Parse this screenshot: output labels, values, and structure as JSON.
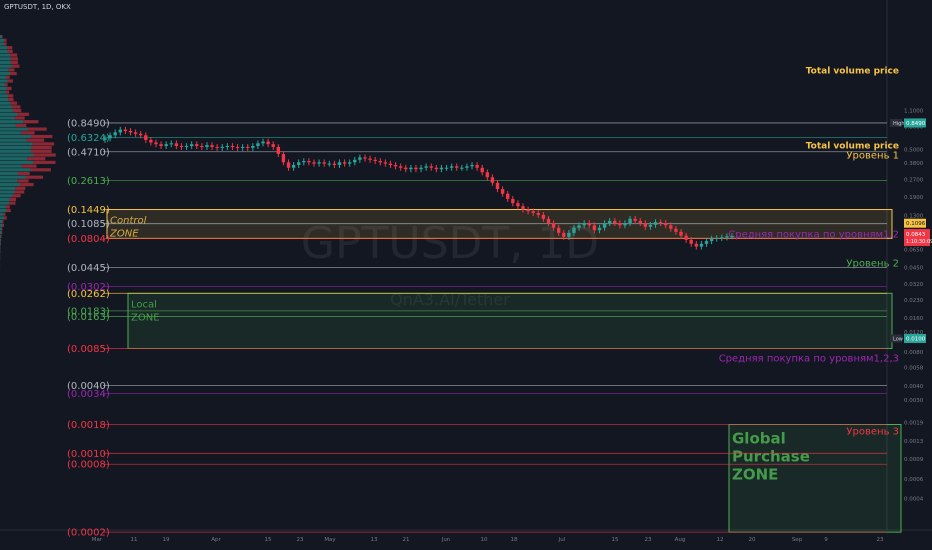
{
  "header": {
    "title": "GPTUSDT, 1D, OKX"
  },
  "watermark": {
    "ticker": "GPTUSDT, 1D",
    "desc": "QnA3.AI/Tether"
  },
  "chart_data": {
    "type": "candlestick",
    "symbol": "GPTUSDT",
    "scale": "log",
    "ylim": [
      0.0001,
      1.5
    ],
    "y_ticks": [
      1.1,
      0.8,
      0.5,
      0.38,
      0.27,
      0.19,
      0.13,
      0.09,
      0.065,
      0.045,
      0.032,
      0.023,
      0.016,
      0.012,
      0.008,
      0.0058,
      0.004,
      0.003,
      0.0019,
      0.0013,
      0.0009,
      0.0006,
      0.0004,
      0.0002,
      0.0001
    ],
    "x_ticks": [
      "Mar",
      "11",
      "19",
      "Apr",
      "15",
      "23",
      "May",
      "13",
      "21",
      "Jun",
      "10",
      "18",
      "Jul",
      "15",
      "23",
      "Aug",
      "12",
      "20",
      "Sep",
      "9",
      "23"
    ],
    "current_price": "0.1096",
    "price_tags": [
      "0.0843",
      "1:10:30:09"
    ],
    "high_label": "High",
    "high_value": "0.8490",
    "low_label": "Low",
    "low_value": "0.0100",
    "levels": [
      {
        "label": "(0.8490)",
        "value": 0.849,
        "color": "#b2b5be"
      },
      {
        "label": "(0.6324)",
        "value": 0.6324,
        "color": "#26a69a"
      },
      {
        "label": "(0.4710)",
        "value": 0.471,
        "color": "#b2b5be"
      },
      {
        "label": "(0.2613)",
        "value": 0.2613,
        "color": "#4caf50"
      },
      {
        "label": "(0.1449)",
        "value": 0.1449,
        "color": "#f6c343"
      },
      {
        "label": "(0.1085)",
        "value": 0.1085,
        "color": "#b2b5be"
      },
      {
        "label": "(0.0804)",
        "value": 0.0804,
        "color": "#f23645"
      },
      {
        "label": "(0.0445)",
        "value": 0.0445,
        "color": "#b2b5be"
      },
      {
        "label": "(0.0302)",
        "value": 0.0302,
        "color": "#9c27b0"
      },
      {
        "label": "(0.0262)",
        "value": 0.0262,
        "color": "#f6c343"
      },
      {
        "label": "(0.0183)",
        "value": 0.0183,
        "color": "#4caf50"
      },
      {
        "label": "(0.0163)",
        "value": 0.0163,
        "color": "#4caf50"
      },
      {
        "label": "(0.0085)",
        "value": 0.0085,
        "color": "#f23645"
      },
      {
        "label": "(0.0040)",
        "value": 0.004,
        "color": "#b2b5be"
      },
      {
        "label": "(0.0034)",
        "value": 0.0034,
        "color": "#9c27b0"
      },
      {
        "label": "(0.0018)",
        "value": 0.0018,
        "color": "#f23645"
      },
      {
        "label": "(0.0010)",
        "value": 0.001,
        "color": "#f23645"
      },
      {
        "label": "(0.0008)",
        "value": 0.0008,
        "color": "#f23645"
      },
      {
        "label": "(0.0002)",
        "value": 0.0002,
        "color": "#f23645"
      }
    ],
    "annotations": [
      {
        "text": "Total volume price",
        "color": "#f6c343"
      },
      {
        "text": "Total volume price",
        "color": "#f6c343"
      },
      {
        "text": "Уровень 1",
        "color": "#f6c343"
      },
      {
        "text": "Средняя покупка по уровням1,2",
        "color": "#9c27b0"
      },
      {
        "text": "Уровень 2",
        "color": "#4caf50"
      },
      {
        "text": "Средняя покупка по уровням1,2,3",
        "color": "#9c27b0"
      },
      {
        "text": "Уровень 3",
        "color": "#f23645"
      }
    ],
    "zones": [
      {
        "name": "Control ZONE",
        "line1": "Control",
        "line2": "ZONE",
        "top": 0.1449,
        "bottom": 0.0804,
        "color": "#f6c343"
      },
      {
        "name": "Local ZONE",
        "line1": "Local",
        "line2": "ZONE",
        "top": 0.0262,
        "bottom": 0.0085,
        "color": "#4caf50"
      },
      {
        "name": "Global Purchase ZONE",
        "line1": "Global",
        "line2": "Purchase",
        "line3": "ZONE",
        "top": 0.0018,
        "bottom": 0.0002,
        "color": "#4caf50"
      }
    ],
    "series": [
      {
        "values": [
          0.62,
          0.66,
          0.7,
          0.74,
          0.72,
          0.7,
          0.68,
          0.66,
          0.6,
          0.57,
          0.55,
          0.53,
          0.55,
          0.56,
          0.53,
          0.52,
          0.53,
          0.55,
          0.53,
          0.52,
          0.54,
          0.52,
          0.51,
          0.52,
          0.53,
          0.52,
          0.51,
          0.52,
          0.51,
          0.53,
          0.56,
          0.58,
          0.55,
          0.52,
          0.45,
          0.38,
          0.34,
          0.36,
          0.38,
          0.39,
          0.38,
          0.37,
          0.38,
          0.37,
          0.37,
          0.36,
          0.38,
          0.37,
          0.38,
          0.4,
          0.42,
          0.41,
          0.4,
          0.39,
          0.38,
          0.37,
          0.36,
          0.35,
          0.34,
          0.33,
          0.34,
          0.33,
          0.34,
          0.35,
          0.34,
          0.33,
          0.34,
          0.34,
          0.35,
          0.34,
          0.34,
          0.35,
          0.36,
          0.34,
          0.31,
          0.28,
          0.25,
          0.22,
          0.2,
          0.18,
          0.165,
          0.155,
          0.145,
          0.14,
          0.135,
          0.13,
          0.12,
          0.11,
          0.1,
          0.09,
          0.083,
          0.09,
          0.1,
          0.105,
          0.11,
          0.105,
          0.095,
          0.1,
          0.11,
          0.115,
          0.11,
          0.105,
          0.11,
          0.12,
          0.115,
          0.11,
          0.102,
          0.106,
          0.112,
          0.11,
          0.105,
          0.098,
          0.092,
          0.085,
          0.078,
          0.072,
          0.068,
          0.072,
          0.076,
          0.08,
          0.081,
          0.082,
          0.084,
          0.0843
        ]
      }
    ]
  }
}
